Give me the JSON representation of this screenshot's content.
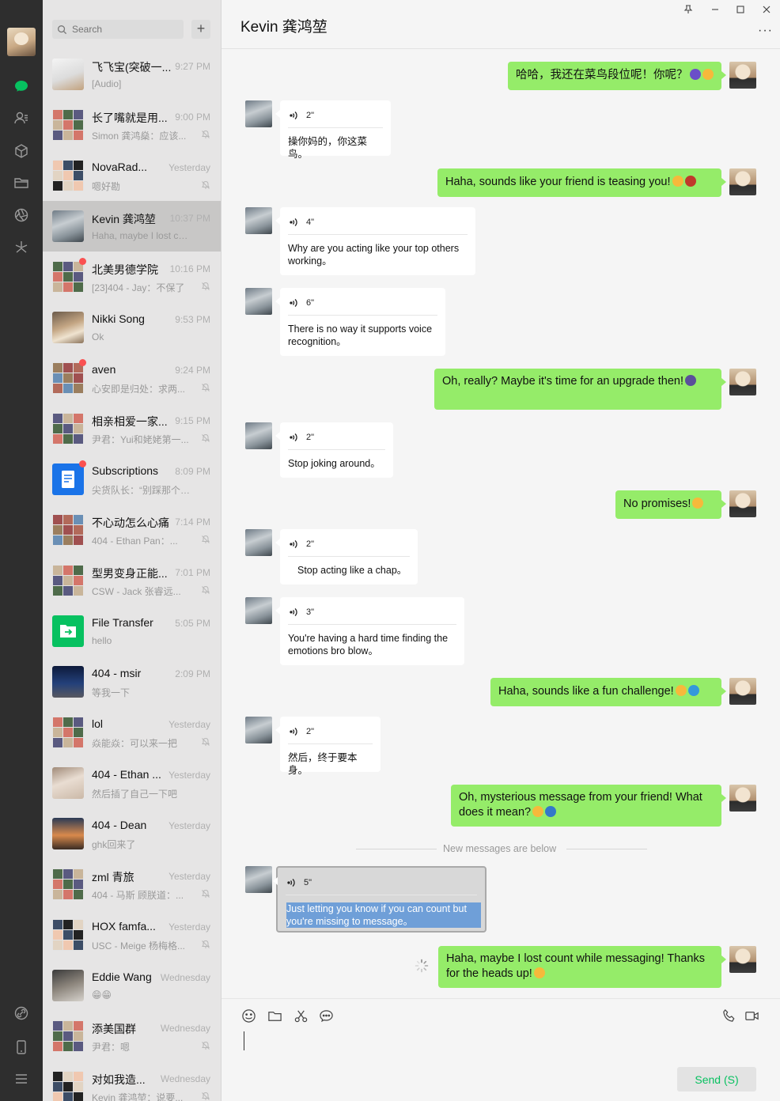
{
  "search": {
    "placeholder": "Search"
  },
  "list": {
    "add_label": "+",
    "items": [
      {
        "name": "飞飞宝(突破一...",
        "time": "9:27 PM",
        "preview": "[Audio]"
      },
      {
        "name": "长了嘴就是用...",
        "time": "9:00 PM",
        "preview": "Simon 龚鸿燊：应该..."
      },
      {
        "name": "NovaRad...",
        "time": "Yesterday",
        "preview": "嗯好勘"
      },
      {
        "name": "Kevin 龚鸿堃",
        "time": "10:37 PM",
        "preview": "Haha, maybe I lost cou..."
      },
      {
        "name": "北美男德学院",
        "time": "10:16 PM",
        "preview": "[23]404 - Jay：不保了"
      },
      {
        "name": "Nikki Song",
        "time": "9:53 PM",
        "preview": "Ok"
      },
      {
        "name": "aven",
        "time": "9:24 PM",
        "preview": "心安即是归处：求两..."
      },
      {
        "name": "相亲相爱一家...",
        "time": "9:15 PM",
        "preview": "尹君：Yui和姥姥第一..."
      },
      {
        "name": "Subscriptions",
        "time": "8:09 PM",
        "preview": "尖货队长：“别踩那个女..."
      },
      {
        "name": "不心动怎么心痛",
        "time": "7:14 PM",
        "preview": "404 - Ethan Pan：..."
      },
      {
        "name": "型男变身正能...",
        "time": "7:01 PM",
        "preview": "CSW - Jack 张睿远..."
      },
      {
        "name": "File Transfer",
        "time": "5:05 PM",
        "preview": "hello"
      },
      {
        "name": "404 - msir",
        "time": "2:09 PM",
        "preview": "等我一下"
      },
      {
        "name": "lol",
        "time": "Yesterday",
        "preview": "焱能焱：可以来一把"
      },
      {
        "name": "404 - Ethan ...",
        "time": "Yesterday",
        "preview": "然后插了自己一下吧"
      },
      {
        "name": "404 - Dean",
        "time": "Yesterday",
        "preview": "ghk回来了"
      },
      {
        "name": "zml 青旅",
        "time": "Yesterday",
        "preview": "404 - 马斯 顾朕道：..."
      },
      {
        "name": "HOX famfa...",
        "time": "Yesterday",
        "preview": "USC - Meige 杨梅格..."
      },
      {
        "name": "Eddie Wang",
        "time": "Wednesday",
        "preview": "😁😁"
      },
      {
        "name": "添美国群",
        "time": "Wednesday",
        "preview": "尹君：嗯"
      },
      {
        "name": "对如我造...",
        "time": "Wednesday",
        "preview": "Kevin 龚鸿堃：说要..."
      }
    ]
  },
  "chat": {
    "title": "Kevin 龚鸿堃",
    "more_label": "···",
    "messages": [
      {
        "dir": "out",
        "text": "哈哈，我还在菜鸟段位呢！你呢？"
      },
      {
        "dir": "in",
        "duration": "2\"",
        "text": "操你妈的，你这菜鸟。"
      },
      {
        "dir": "out",
        "text": "Haha, sounds like your friend is teasing you!"
      },
      {
        "dir": "in",
        "duration": "4\"",
        "text": "Why are you acting like your top others working。"
      },
      {
        "dir": "in",
        "duration": "6\"",
        "text": "There is no way it supports voice recognition。"
      },
      {
        "dir": "out",
        "text": "Oh, really? Maybe it's time for an upgrade then!"
      },
      {
        "dir": "in",
        "duration": "2\"",
        "text": "Stop joking around。"
      },
      {
        "dir": "out",
        "text": "No promises!"
      },
      {
        "dir": "in",
        "duration": "2\"",
        "text": "Stop acting like a chap。"
      },
      {
        "dir": "in",
        "duration": "3\"",
        "text": "You're having a hard time finding the emotions bro blow。"
      },
      {
        "dir": "out",
        "text": "Haha, sounds like a fun challenge!"
      },
      {
        "dir": "in",
        "duration": "2\"",
        "text": "然后，终于要本身。"
      },
      {
        "dir": "out",
        "text": "Oh, mysterious message from your friend! What does it mean?"
      },
      {
        "dir": "in",
        "duration": "5\"",
        "text": "Just letting you know if you can count but you're missing to message。"
      },
      {
        "dir": "out",
        "text": "Haha, maybe I lost count while messaging! Thanks for the heads up!"
      }
    ],
    "divider": "New messages are below",
    "send_label": "Send (S)"
  },
  "colors": {
    "bubble_out": "#95ec69",
    "send_text": "#07c160",
    "unread": "#fa5151",
    "rail": "#2e2e2e"
  }
}
